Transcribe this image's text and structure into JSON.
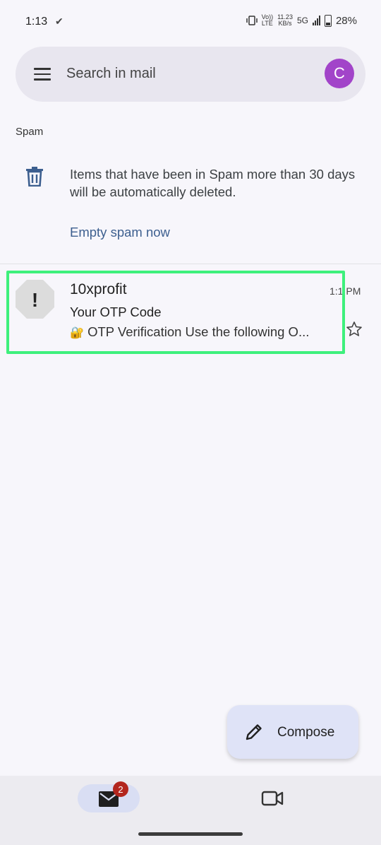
{
  "status_bar": {
    "time": "1:13",
    "check_glyph": "✔",
    "volte_top": "Vo))",
    "volte_bottom": "LTE",
    "speed_top": "11.23",
    "speed_bottom": "KB/s",
    "network": "5G",
    "battery": "28%"
  },
  "search": {
    "placeholder": "Search in mail",
    "avatar_letter": "C",
    "avatar_color": "#a244c9"
  },
  "folder": {
    "label": "Spam"
  },
  "notice": {
    "text": "Items that have been in Spam more than 30 days will be automatically deleted.",
    "action": "Empty spam now"
  },
  "emails": [
    {
      "sender": "10xprofit",
      "time": "1:1 PM",
      "subject": "Your OTP Code",
      "snippet_emoji": "🔐",
      "snippet": "OTP Verification Use the following O...",
      "avatar_glyph": "!",
      "highlight_color": "#3ef07c"
    }
  ],
  "compose": {
    "label": "Compose"
  },
  "bottom_nav": {
    "mail_badge": "2",
    "mail_icon": "mail-icon",
    "meet_icon": "video-icon"
  }
}
